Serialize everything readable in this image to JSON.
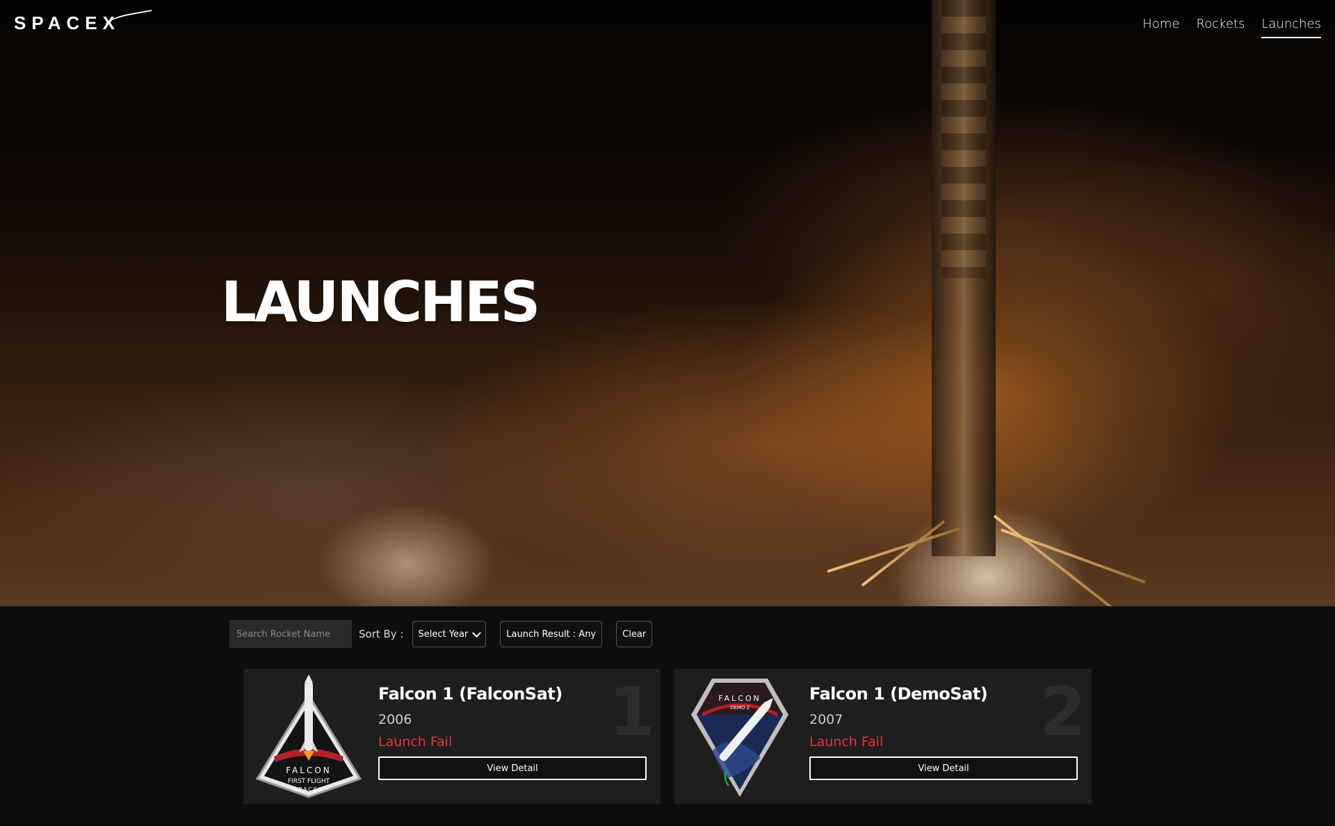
{
  "header": {
    "logo_text": "SPACEX",
    "nav": [
      {
        "label": "Home",
        "active": false
      },
      {
        "label": "Rockets",
        "active": false
      },
      {
        "label": "Launches",
        "active": true
      }
    ]
  },
  "hero": {
    "title": "LAUNCHES"
  },
  "filters": {
    "search_placeholder": "Search Rocket Name",
    "sort_label": "Sort By :",
    "year_select": "Select Year",
    "launch_result": "Launch Result : Any",
    "clear": "Clear"
  },
  "launches": [
    {
      "number": "1",
      "name": "Falcon 1 (FalconSat)",
      "year": "2006",
      "result": "Launch Fail",
      "button": "View Detail",
      "patch_text": [
        "FALCON",
        "FIRST FLIGHT",
        "SPACEX"
      ]
    },
    {
      "number": "2",
      "name": "Falcon 1 (DemoSat)",
      "year": "2007",
      "result": "Launch Fail",
      "button": "View Detail",
      "patch_text": [
        "FALCON",
        "DEMO 2"
      ]
    }
  ],
  "colors": {
    "fail": "#e03a3a",
    "card_bg": "#1e1e1e",
    "page_bg": "#0e0e0e"
  }
}
